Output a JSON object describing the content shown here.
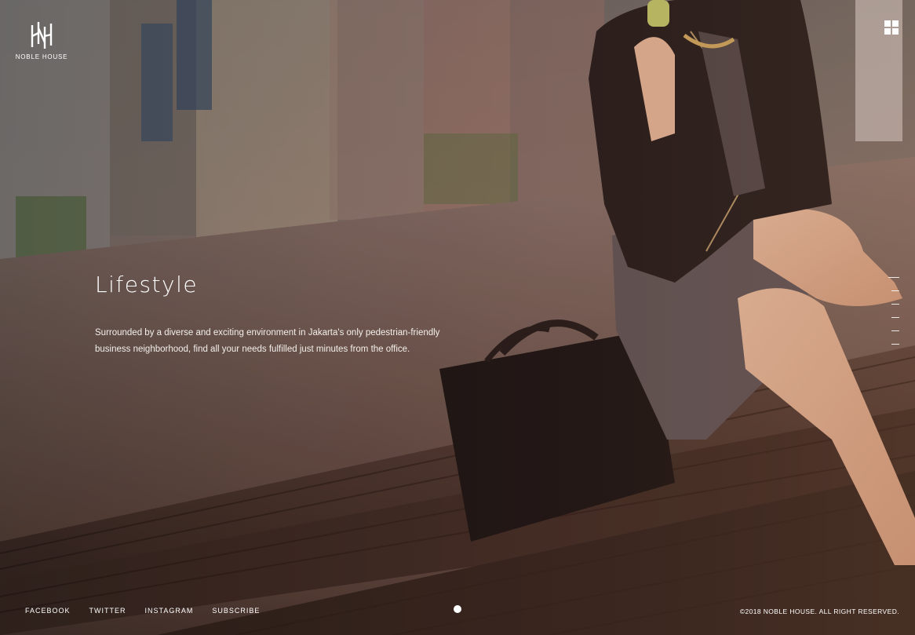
{
  "brand": {
    "logo_icon": "nh-monogram-icon",
    "name": "NOBLE HOUSE"
  },
  "menu": {
    "icon": "grid-menu-icon"
  },
  "hero": {
    "title": "Lifestyle",
    "description": "Surrounded by a diverse and exciting environment in Jakarta's only pedestrian-friendly business neighborhood, find all your needs fulfilled just minutes from the office."
  },
  "side_nav": {
    "count": 6,
    "active_index": 0
  },
  "footer": {
    "links": [
      "FACEBOOK",
      "TWITTER",
      "INSTAGRAM",
      "SUBSCRIBE"
    ],
    "copyright": "©2018 NOBLE HOUSE. ALL RIGHT RESERVED."
  },
  "slider": {
    "dots": 1,
    "active": 0
  },
  "colors": {
    "text": "#ffffff",
    "wood_dark": "#3a2a24",
    "jacket": "#1c1718"
  }
}
